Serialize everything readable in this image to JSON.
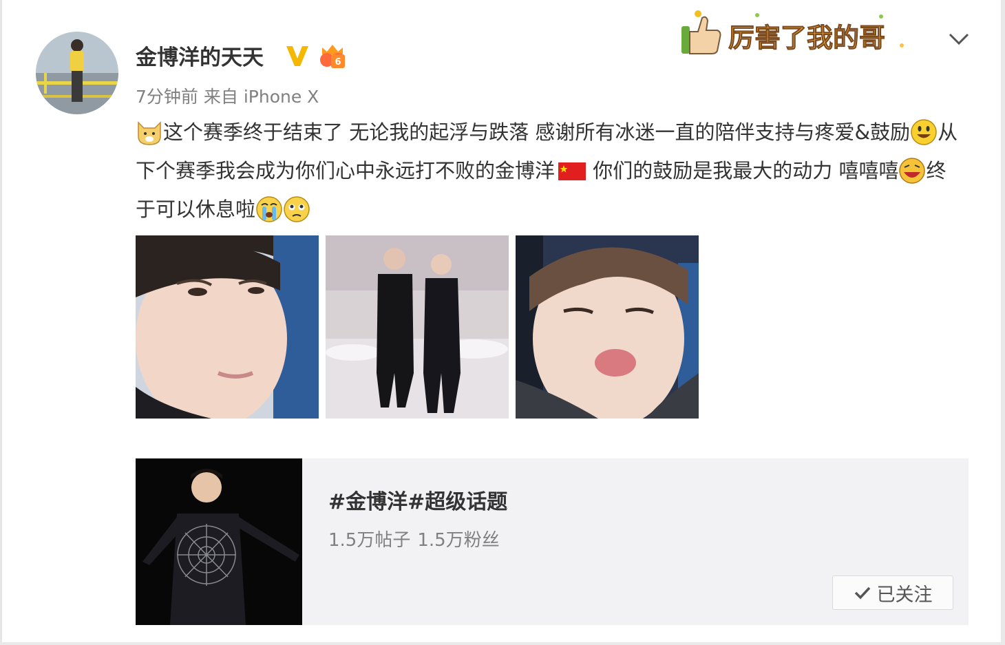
{
  "post": {
    "username": "金博洋的天天",
    "time": "7分钟前",
    "source": "来自 iPhone X",
    "text_part1": "这个赛季终于结束了 无论我的起浮与跌落 感谢所有冰迷一直的陪伴支持与疼爱&鼓励",
    "text_part2": "从下个赛季我会成为你们心中永远打不败的金博洋",
    "text_part3": " 你们的鼓励是我最大的动力 嘻嘻嘻",
    "text_part4": "终于可以休息啦",
    "stamp_text": "厉害了我的哥",
    "images": [
      "photo-1",
      "photo-2",
      "photo-3"
    ]
  },
  "topic": {
    "title": "#金博洋#超级话题",
    "posts": "1.5万帖子",
    "fans": "1.5万粉丝",
    "follow_label": "已关注"
  },
  "icons": {
    "verified": "verified-v-icon",
    "member": "vip-member-icon",
    "dropdown": "chevron-down-icon",
    "check": "check-icon"
  },
  "colors": {
    "text": "#333333",
    "meta": "#808080",
    "verified": "#f5b800",
    "member": "#ff7a2a",
    "card_bg": "#f2f2f5"
  }
}
